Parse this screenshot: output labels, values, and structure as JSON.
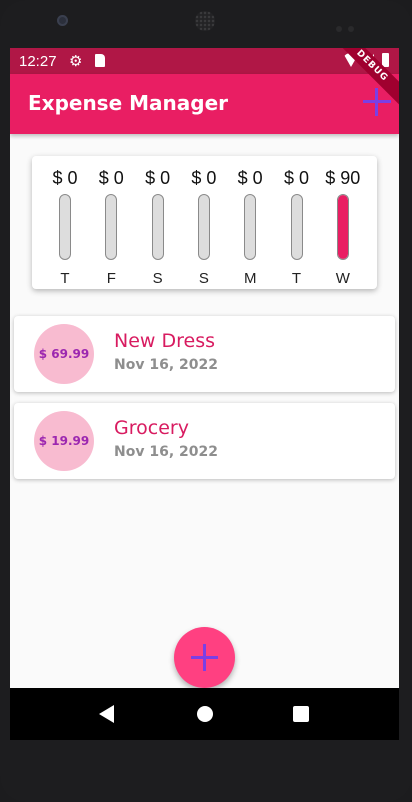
{
  "status_bar": {
    "time": "12:27"
  },
  "app_bar": {
    "title": "Expense Manager",
    "debug_label": "DEBUG"
  },
  "chart_data": {
    "type": "bar",
    "categories": [
      "T",
      "F",
      "S",
      "S",
      "M",
      "T",
      "W"
    ],
    "value_labels": [
      "$ 0",
      "$ 0",
      "$ 0",
      "$ 0",
      "$ 0",
      "$ 0",
      "$ 90"
    ],
    "values": [
      0,
      0,
      0,
      0,
      0,
      0,
      89.98
    ],
    "total": 89.98
  },
  "expenses": [
    {
      "amount": "$ 69.99",
      "title": "New Dress",
      "date": "Nov 16, 2022"
    },
    {
      "amount": "$ 19.99",
      "title": "Grocery",
      "date": "Nov 16, 2022"
    }
  ],
  "colors": {
    "primary": "#e91e63",
    "status_bar": "#b01746",
    "accent": "#ff4081",
    "avatar_bg": "#f8bbd0",
    "avatar_text": "#9c27b0",
    "icon": "#7b3fe4"
  },
  "icons": {
    "settings": "gear-icon",
    "sd_card": "sd-card-icon",
    "wifi": "wifi-icon",
    "signal": "signal-icon",
    "battery": "battery-icon",
    "add": "plus-icon"
  }
}
